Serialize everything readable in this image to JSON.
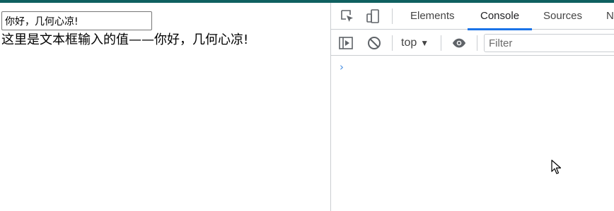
{
  "page": {
    "input_value": "你好，几何心凉!",
    "output_text": "这里是文本框输入的值——你好，几何心凉!"
  },
  "devtools": {
    "tabs": [
      {
        "label": "Elements",
        "active": false
      },
      {
        "label": "Console",
        "active": true
      },
      {
        "label": "Sources",
        "active": false
      },
      {
        "label": "N",
        "active": false
      }
    ],
    "icons": {
      "inspect": "inspect-element-icon",
      "device": "device-toolbar-icon",
      "sidebar": "console-sidebar-icon",
      "clear": "clear-console-icon",
      "eye": "live-expression-icon"
    },
    "toolbar": {
      "context": "top",
      "filter_placeholder": "Filter"
    },
    "console": {
      "prompt_symbol": "›"
    },
    "accent_color": "#1a73e8"
  },
  "colors": {
    "top_strip": "#0f6060"
  }
}
